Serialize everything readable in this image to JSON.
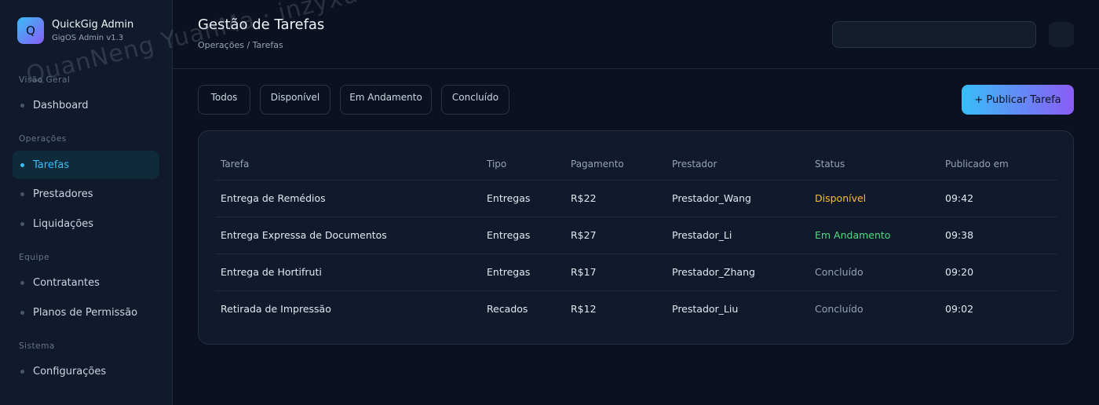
{
  "brand": {
    "logo_letter": "Q",
    "name": "QuickGig Admin",
    "version": "GigOS Admin v1.3"
  },
  "sidebar": {
    "sections": [
      {
        "label": "Visão Geral",
        "items": [
          {
            "label": "Dashboard"
          }
        ]
      },
      {
        "label": "Operações",
        "items": [
          {
            "label": "Tarefas",
            "active": true
          },
          {
            "label": "Prestadores"
          },
          {
            "label": "Liquidações"
          }
        ]
      },
      {
        "label": "Equipe",
        "items": [
          {
            "label": "Contratantes"
          },
          {
            "label": "Planos de Permissão"
          }
        ]
      },
      {
        "label": "Sistema",
        "items": [
          {
            "label": "Configurações"
          }
        ]
      }
    ]
  },
  "header": {
    "title": "Gestão de Tarefas",
    "breadcrumb": "Operações / Tarefas"
  },
  "filters": [
    "Todos",
    "Disponível",
    "Em Andamento",
    "Concluído"
  ],
  "publish_button": "+ Publicar Tarefa",
  "table": {
    "columns": [
      "Tarefa",
      "Tipo",
      "Pagamento",
      "Prestador",
      "Status",
      "Publicado em"
    ],
    "rows": [
      {
        "task": "Entrega de Remédios",
        "type": "Entregas",
        "payment": "R$22",
        "provider": "Prestador_Wang",
        "status": "Disponível",
        "time": "09:42"
      },
      {
        "task": "Entrega Expressa de Documentos",
        "type": "Entregas",
        "payment": "R$27",
        "provider": "Prestador_Li",
        "status": "Em Andamento",
        "time": "09:38"
      },
      {
        "task": "Entrega de Hortifruti",
        "type": "Entregas",
        "payment": "R$17",
        "provider": "Prestador_Zhang",
        "status": "Concluído",
        "time": "09:20"
      },
      {
        "task": "Retirada de Impressão",
        "type": "Recados",
        "payment": "R$12",
        "provider": "Prestador_Liu",
        "status": "Concluído",
        "time": "09:02"
      }
    ]
  },
  "watermark": "QuanNeng YuanMa · inzyxuashop.com",
  "colors": {
    "accent": "#38bdf8",
    "accent2": "#8b5cf6",
    "available": "#fbbf24",
    "in_progress": "#4ade80",
    "done": "#94a3b8"
  }
}
